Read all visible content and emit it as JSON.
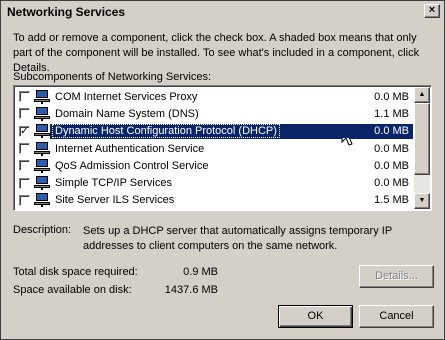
{
  "window": {
    "title": "Networking Services",
    "close_glyph": "×"
  },
  "instructions": "To add or remove a component, click the check box. A shaded box means that only part of the component will be installed. To see what's included in a component, click Details.",
  "subcomponents_label": "Subcomponents of Networking Services:",
  "components": [
    {
      "label": "COM Internet Services Proxy",
      "size": "0.0 MB",
      "checked": false,
      "selected": false
    },
    {
      "label": "Domain Name System (DNS)",
      "size": "1.1 MB",
      "checked": false,
      "selected": false
    },
    {
      "label": "Dynamic Host Configuration Protocol (DHCP)",
      "size": "0.0 MB",
      "checked": true,
      "selected": true
    },
    {
      "label": "Internet Authentication Service",
      "size": "0.0 MB",
      "checked": false,
      "selected": false
    },
    {
      "label": "QoS Admission Control Service",
      "size": "0.0 MB",
      "checked": false,
      "selected": false
    },
    {
      "label": "Simple TCP/IP Services",
      "size": "0.0 MB",
      "checked": false,
      "selected": false
    },
    {
      "label": "Site Server ILS Services",
      "size": "1.5 MB",
      "checked": false,
      "selected": false
    }
  ],
  "check_glyph": "✓",
  "description": {
    "label": "Description:",
    "text": "Sets up a DHCP server that automatically assigns temporary IP addresses to client computers on the same network."
  },
  "disk": {
    "required_label": "Total disk space required:",
    "required_value": "0.9 MB",
    "available_label": "Space available on disk:",
    "available_value": "1437.6 MB"
  },
  "buttons": {
    "details": "Details...",
    "ok": "OK",
    "cancel": "Cancel"
  },
  "icons": {
    "component": "network-computer-icon",
    "cursor": "mouse-pointer-icon"
  }
}
